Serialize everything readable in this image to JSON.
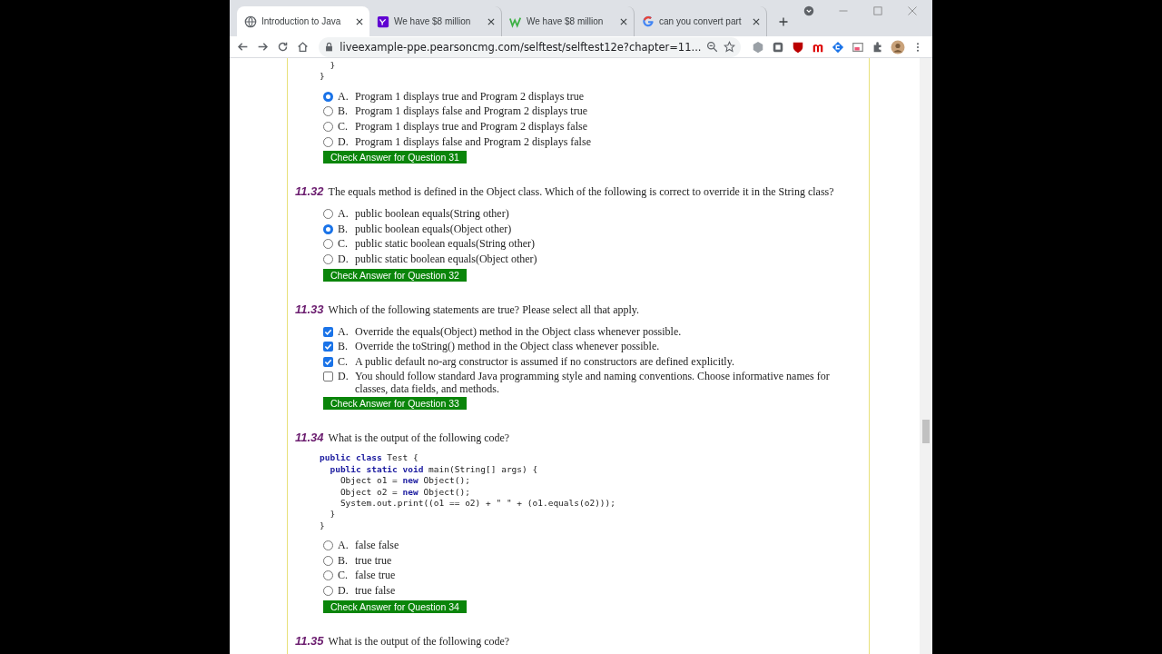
{
  "browser": {
    "tabs": [
      {
        "title": "Introduction to Java",
        "kind": "globe",
        "selected": true
      },
      {
        "title": "We have $8 million",
        "kind": "yahoo",
        "selected": false
      },
      {
        "title": "We have $8 million",
        "kind": "w",
        "selected": false
      },
      {
        "title": "can you convert part",
        "kind": "google",
        "selected": false
      }
    ],
    "address": "liveexample-ppe.pearsoncmg.com/selftest/selftest12e?chapter=11..."
  },
  "questions": [
    {
      "kind": "radio",
      "code": [
        [
          {
            "t": "  }",
            "kind": "plain"
          }
        ],
        [
          {
            "t": "}",
            "kind": "plain"
          }
        ]
      ],
      "options": [
        {
          "letter": "A.",
          "text": "Program 1 displays true and Program 2 displays true",
          "selected": true
        },
        {
          "letter": "B.",
          "text": "Program 1 displays false and Program 2 displays true",
          "selected": false
        },
        {
          "letter": "C.",
          "text": "Program 1 displays true and Program 2 displays false",
          "selected": false
        },
        {
          "letter": "D.",
          "text": "Program 1 displays false and Program 2 displays false",
          "selected": false
        }
      ],
      "button": "Check Answer for Question 31"
    },
    {
      "number": "11.32",
      "text": "The equals method is defined in the Object class. Which of the following is correct to override it in the String class?",
      "kind": "radio",
      "options": [
        {
          "letter": "A.",
          "text": "public boolean equals(String other)",
          "selected": false
        },
        {
          "letter": "B.",
          "text": "public boolean equals(Object other)",
          "selected": true
        },
        {
          "letter": "C.",
          "text": "public static boolean equals(String other)",
          "selected": false
        },
        {
          "letter": "D.",
          "text": "public static boolean equals(Object other)",
          "selected": false
        }
      ],
      "button": "Check Answer for Question 32"
    },
    {
      "number": "11.33",
      "text": "Which of the following statements are true? Please select all that apply.",
      "kind": "checkbox",
      "options": [
        {
          "letter": "A.",
          "text": "Override the equals(Object) method in the Object class whenever possible.",
          "checked": true
        },
        {
          "letter": "B.",
          "text": "Override the toString() method in the Object class whenever possible.",
          "checked": true
        },
        {
          "letter": "C.",
          "text": "A public default no-arg constructor is assumed if no constructors are defined explicitly.",
          "checked": true
        },
        {
          "letter": "D.",
          "text": "You should follow standard Java programming style and naming conventions. Choose informative names for classes, data fields, and methods.",
          "checked": false
        }
      ],
      "button": "Check Answer for Question 33"
    },
    {
      "number": "11.34",
      "text": "What is the output of the following code?",
      "kind": "radio",
      "code": [
        [
          {
            "t": "public class",
            "kind": "keyword"
          },
          {
            "t": " Test {",
            "kind": "plain"
          }
        ],
        [
          {
            "t": "  public static void",
            "kind": "keyword"
          },
          {
            "t": " main(String[] args) {",
            "kind": "plain"
          }
        ],
        [
          {
            "t": "    Object o1 = ",
            "kind": "plain"
          },
          {
            "t": "new",
            "kind": "keyword"
          },
          {
            "t": " Object();",
            "kind": "plain"
          }
        ],
        [
          {
            "t": "    Object o2 = ",
            "kind": "plain"
          },
          {
            "t": "new",
            "kind": "keyword"
          },
          {
            "t": " Object();",
            "kind": "plain"
          }
        ],
        [
          {
            "t": "    System.out.print((o1 == o2) + \" \" + (o1.equals(o2)));",
            "kind": "plain"
          }
        ],
        [
          {
            "t": "  }",
            "kind": "plain"
          }
        ],
        [
          {
            "t": "}",
            "kind": "plain"
          }
        ]
      ],
      "options": [
        {
          "letter": "A.",
          "text": "false false",
          "selected": false
        },
        {
          "letter": "B.",
          "text": "true true",
          "selected": false
        },
        {
          "letter": "C.",
          "text": "false true",
          "selected": false
        },
        {
          "letter": "D.",
          "text": "true false",
          "selected": false
        }
      ],
      "button": "Check Answer for Question 34"
    },
    {
      "number": "11.35",
      "text": "What is the output of the following code?"
    }
  ]
}
